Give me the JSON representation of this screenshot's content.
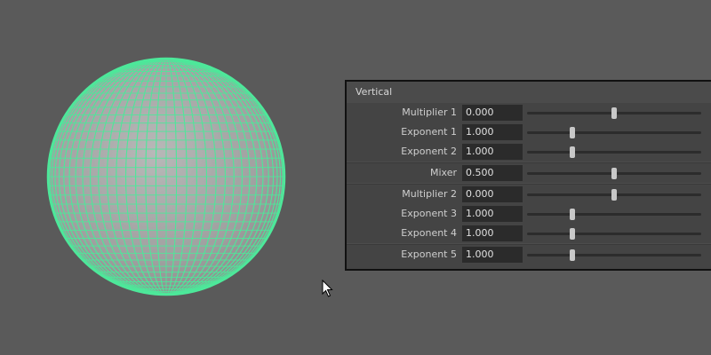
{
  "panel": {
    "title": "Vertical",
    "groups": [
      {
        "rows": [
          {
            "label": "Multiplier 1",
            "value": "0.000",
            "slider": 0.5
          },
          {
            "label": "Exponent 1",
            "value": "1.000",
            "slider": 0.26
          },
          {
            "label": "Exponent 2",
            "value": "1.000",
            "slider": 0.26
          }
        ]
      },
      {
        "rows": [
          {
            "label": "Mixer",
            "value": "0.500",
            "slider": 0.5
          }
        ]
      },
      {
        "rows": [
          {
            "label": "Multiplier 2",
            "value": "0.000",
            "slider": 0.5
          },
          {
            "label": "Exponent 3",
            "value": "1.000",
            "slider": 0.26
          },
          {
            "label": "Exponent 4",
            "value": "1.000",
            "slider": 0.26
          }
        ]
      },
      {
        "rows": [
          {
            "label": "Exponent 5",
            "value": "1.000",
            "slider": 0.26
          }
        ]
      }
    ]
  },
  "viewport": {
    "object": "sphere",
    "wireframe_color": "#4de89a",
    "surface_color": "#a8a8a8",
    "background_color": "#5a5a5a"
  },
  "icons": {
    "cursor": "mouse-pointer-icon"
  }
}
